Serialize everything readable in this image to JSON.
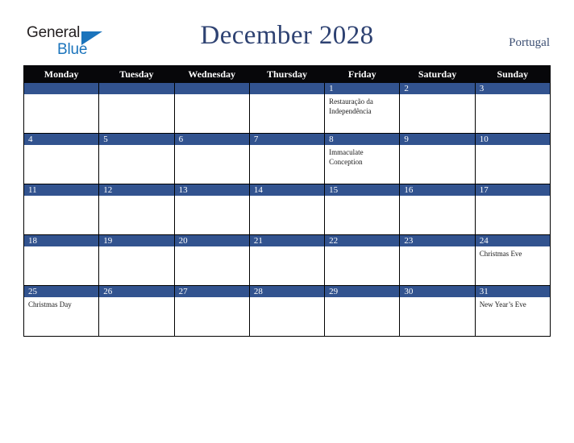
{
  "logo": {
    "word_one": "General",
    "word_two": "Blue",
    "triangle_icon": "triangle-icon",
    "brand_blue": "#1b74bc",
    "brand_dark": "#231f20"
  },
  "header": {
    "title": "December 2028",
    "country": "Portugal",
    "title_color": "#2e4272"
  },
  "colors": {
    "header_row_bg": "#07070a",
    "day_band_bg": "#32538f",
    "grid_border": "#000000",
    "cell_bg": "#ffffff"
  },
  "calendar": {
    "weekdays": [
      "Monday",
      "Tuesday",
      "Wednesday",
      "Thursday",
      "Friday",
      "Saturday",
      "Sunday"
    ],
    "weeks": [
      [
        {
          "day": "",
          "event": ""
        },
        {
          "day": "",
          "event": ""
        },
        {
          "day": "",
          "event": ""
        },
        {
          "day": "",
          "event": ""
        },
        {
          "day": "1",
          "event": "Restauração da Independência"
        },
        {
          "day": "2",
          "event": ""
        },
        {
          "day": "3",
          "event": ""
        }
      ],
      [
        {
          "day": "4",
          "event": ""
        },
        {
          "day": "5",
          "event": ""
        },
        {
          "day": "6",
          "event": ""
        },
        {
          "day": "7",
          "event": ""
        },
        {
          "day": "8",
          "event": "Immaculate Conception"
        },
        {
          "day": "9",
          "event": ""
        },
        {
          "day": "10",
          "event": ""
        }
      ],
      [
        {
          "day": "11",
          "event": ""
        },
        {
          "day": "12",
          "event": ""
        },
        {
          "day": "13",
          "event": ""
        },
        {
          "day": "14",
          "event": ""
        },
        {
          "day": "15",
          "event": ""
        },
        {
          "day": "16",
          "event": ""
        },
        {
          "day": "17",
          "event": ""
        }
      ],
      [
        {
          "day": "18",
          "event": ""
        },
        {
          "day": "19",
          "event": ""
        },
        {
          "day": "20",
          "event": ""
        },
        {
          "day": "21",
          "event": ""
        },
        {
          "day": "22",
          "event": ""
        },
        {
          "day": "23",
          "event": ""
        },
        {
          "day": "24",
          "event": "Christmas Eve"
        }
      ],
      [
        {
          "day": "25",
          "event": "Christmas Day"
        },
        {
          "day": "26",
          "event": ""
        },
        {
          "day": "27",
          "event": ""
        },
        {
          "day": "28",
          "event": ""
        },
        {
          "day": "29",
          "event": ""
        },
        {
          "day": "30",
          "event": ""
        },
        {
          "day": "31",
          "event": "New Year’s Eve"
        }
      ]
    ]
  }
}
